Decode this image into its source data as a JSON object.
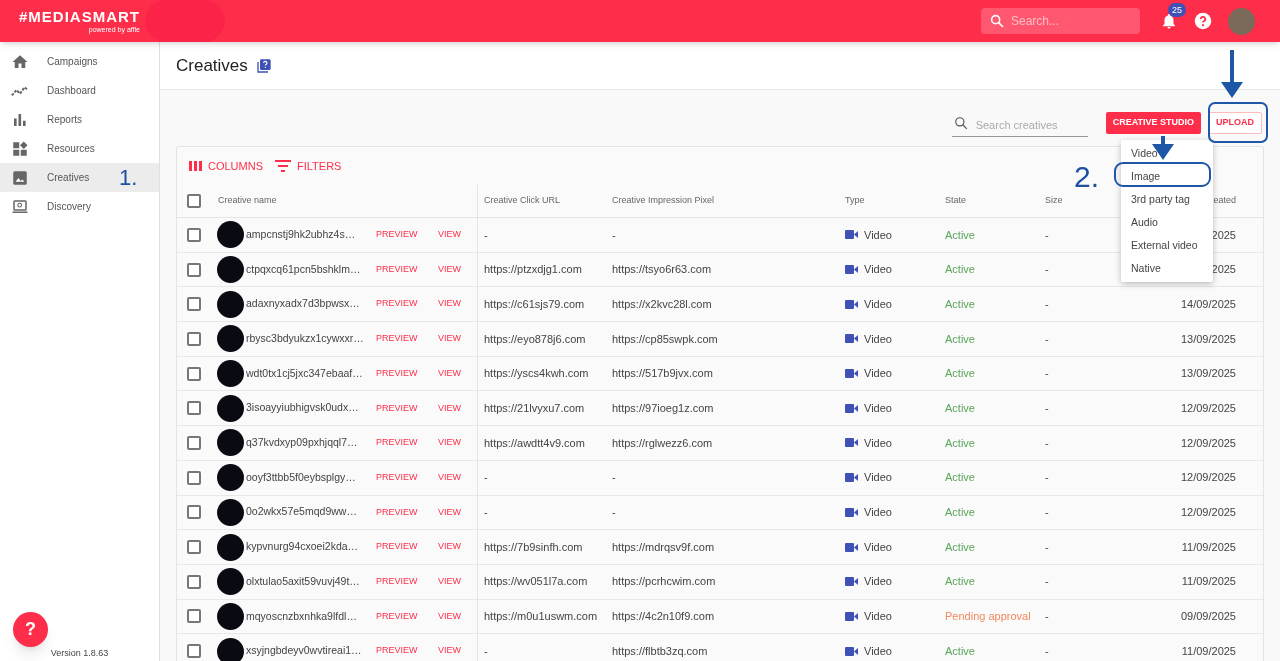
{
  "header": {
    "logo": "#MEDIASMART",
    "logo_sub": "powered by affle",
    "search": {
      "placeholder": "Search..."
    },
    "notifications": "25"
  },
  "sidebar": {
    "items": [
      {
        "label": "Campaigns",
        "selected": false
      },
      {
        "label": "Dashboard",
        "selected": false
      },
      {
        "label": "Reports",
        "selected": false
      },
      {
        "label": "Resources",
        "selected": false
      },
      {
        "label": "Creatives",
        "selected": true
      },
      {
        "label": "Discovery",
        "selected": false
      }
    ],
    "version": "Version 1.8.63",
    "help": "?"
  },
  "page": {
    "title": "Creatives"
  },
  "toolbar": {
    "search": {
      "placeholder": "Search creatives"
    },
    "buttons": [
      {
        "label": "CREATIVE STUDIO",
        "kind": "filled"
      },
      {
        "label": "UPLOAD",
        "kind": "outlined"
      }
    ]
  },
  "table_actions": [
    {
      "label": "COLUMNS"
    },
    {
      "label": "FILTERS"
    }
  ],
  "table": {
    "header_checked": false,
    "columns": [
      "Creative name",
      "Creative Click URL",
      "Creative Impression Pixel",
      "Type",
      "State",
      "Size",
      "eated"
    ],
    "rows": [
      {
        "checked": false,
        "name": "ampcnstj9hk2ubhz4s…",
        "preview": "PREVIEW",
        "view": "VIEW",
        "click_url": "-",
        "pixel": "-",
        "type": "Video",
        "state": "Active",
        "color": "#5aa55a",
        "size": "-",
        "created": "2025"
      },
      {
        "checked": false,
        "name": "ctpqxcq61pcn5bshklm…",
        "preview": "PREVIEW",
        "view": "VIEW",
        "click_url": "https://ptzxdjg1.com",
        "pixel": "https://tsyo6r63.com",
        "type": "Video",
        "state": "Active",
        "color": "#5aa55a",
        "size": "-",
        "created": "2025"
      },
      {
        "checked": false,
        "name": "adaxnyxadx7d3bpwsx…",
        "preview": "PREVIEW",
        "view": "VIEW",
        "click_url": "https://c61sjs79.com",
        "pixel": "https://x2kvc28l.com",
        "type": "Video",
        "state": "Active",
        "color": "#5aa55a",
        "size": "-",
        "created": "14/09/2025"
      },
      {
        "checked": false,
        "name": "rbysc3bdyukzx1cywxxr…",
        "preview": "PREVIEW",
        "view": "VIEW",
        "click_url": "https://eyo878j6.com",
        "pixel": "https://cp85swpk.com",
        "type": "Video",
        "state": "Active",
        "color": "#5aa55a",
        "size": "-",
        "created": "13/09/2025"
      },
      {
        "checked": false,
        "name": "wdt0tx1cj5jxc347ebaaf…",
        "preview": "PREVIEW",
        "view": "VIEW",
        "click_url": "https://yscs4kwh.com",
        "pixel": "https://517b9jvx.com",
        "type": "Video",
        "state": "Active",
        "color": "#5aa55a",
        "size": "-",
        "created": "13/09/2025"
      },
      {
        "checked": false,
        "name": "3isoayyiubhigvsk0udx…",
        "preview": "PREVIEW",
        "view": "VIEW",
        "click_url": "https://21lvyxu7.com",
        "pixel": "https://97ioeg1z.com",
        "type": "Video",
        "state": "Active",
        "color": "#5aa55a",
        "size": "-",
        "created": "12/09/2025"
      },
      {
        "checked": false,
        "name": "q37kvdxyp09pxhjqql7…",
        "preview": "PREVIEW",
        "view": "VIEW",
        "click_url": "https://awdtt4v9.com",
        "pixel": "https://rglwezz6.com",
        "type": "Video",
        "state": "Active",
        "color": "#5aa55a",
        "size": "-",
        "created": "12/09/2025"
      },
      {
        "checked": false,
        "name": "ooyf3ttbb5f0eybsplgy…",
        "preview": "PREVIEW",
        "view": "VIEW",
        "click_url": "-",
        "pixel": "-",
        "type": "Video",
        "state": "Active",
        "color": "#5aa55a",
        "size": "-",
        "created": "12/09/2025"
      },
      {
        "checked": false,
        "name": "0o2wkx57e5mqd9ww…",
        "preview": "PREVIEW",
        "view": "VIEW",
        "click_url": "-",
        "pixel": "-",
        "type": "Video",
        "state": "Active",
        "color": "#5aa55a",
        "size": "-",
        "created": "12/09/2025"
      },
      {
        "checked": false,
        "name": "kypvnurg94cxoei2kda…",
        "preview": "PREVIEW",
        "view": "VIEW",
        "click_url": "https://7b9sinfh.com",
        "pixel": "https://mdrqsv9f.com",
        "type": "Video",
        "state": "Active",
        "color": "#5aa55a",
        "size": "-",
        "created": "11/09/2025"
      },
      {
        "checked": false,
        "name": "olxtulao5axit59vuvj49t…",
        "preview": "PREVIEW",
        "view": "VIEW",
        "click_url": "https://wv051l7a.com",
        "pixel": "https://pcrhcwim.com",
        "type": "Video",
        "state": "Active",
        "color": "#5aa55a",
        "size": "-",
        "created": "11/09/2025"
      },
      {
        "checked": false,
        "name": "mqyoscnzbxnhka9lfdl…",
        "preview": "PREVIEW",
        "view": "VIEW",
        "click_url": "https://m0u1uswm.com",
        "pixel": "https://4c2n10f9.com",
        "type": "Video",
        "state": "Pending approval",
        "color": "#f08a5d",
        "size": "-",
        "created": "09/09/2025"
      },
      {
        "checked": false,
        "name": "xsyjngbdeyv0wvtireai1…",
        "preview": "PREVIEW",
        "view": "VIEW",
        "click_url": "-",
        "pixel": "https://flbtb3zq.com",
        "type": "Video",
        "state": "Active",
        "color": "#5aa55a",
        "size": "-",
        "created": "11/09/2025"
      }
    ]
  },
  "upload_menu": {
    "items": [
      "Video",
      "Image",
      "3rd party tag",
      "Audio",
      "External video",
      "Native"
    ]
  },
  "annotations": [
    {
      "label": "1."
    },
    {
      "label": "2."
    }
  ]
}
